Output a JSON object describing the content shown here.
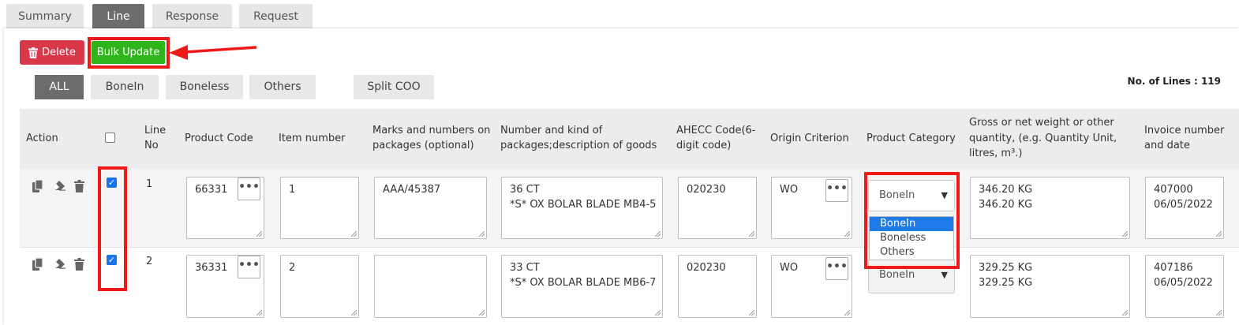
{
  "tabs": [
    "Summary",
    "Line",
    "Response",
    "Request"
  ],
  "active_tab": "Line",
  "toolbar": {
    "delete_label": "Delete",
    "bulk_update_label": "Bulk Update"
  },
  "filters": [
    "ALL",
    "BoneIn",
    "Boneless",
    "Others",
    "Split COO"
  ],
  "active_filter": "ALL",
  "lines_count_label": "No. of Lines : 119",
  "table": {
    "headers": {
      "action": "Action",
      "line_no_1": "Line",
      "line_no_2": "No",
      "product_code": "Product Code",
      "item_number": "Item number",
      "marks_1": "Marks and numbers on",
      "marks_2": "packages (optional)",
      "number_kind_1": "Number and kind of",
      "number_kind_2": "packages;description of goods",
      "ahecc_1": "AHECC Code(6-",
      "ahecc_2": "digit code)",
      "origin": "Origin Criterion",
      "category": "Product Category",
      "weight_1": "Gross or net weight or other",
      "weight_2": "quantity, (e.g. Quantity Unit,",
      "weight_3": "litres, m³.)",
      "invoice_1": "Invoice number",
      "invoice_2": "and date"
    },
    "rows": [
      {
        "checked": true,
        "line_no": "1",
        "product_code": "66331",
        "item_number": "1",
        "marks": "AAA/45387",
        "description": "36 CT\n*S* OX BOLAR BLADE MB4-5",
        "ahecc": "020230",
        "origin": "WO",
        "category": "BoneIn",
        "weight": "346.20 KG\n346.20 KG",
        "invoice": "407000\n06/05/2022"
      },
      {
        "checked": true,
        "line_no": "2",
        "product_code": "36331",
        "item_number": "2",
        "marks": "",
        "description": "33 CT\n*S* OX BOLAR BLADE MB6-7",
        "ahecc": "020230",
        "origin": "WO",
        "category": "BoneIn",
        "weight": "329.25 KG\n329.25 KG",
        "invoice": "407186\n06/05/2022"
      }
    ]
  },
  "category_dropdown": {
    "options": [
      "BoneIn",
      "Boneless",
      "Others"
    ],
    "selected": "BoneIn"
  },
  "colors": {
    "delete": "#d9384b",
    "bulk_update": "#2fb51c",
    "highlight": "#f01919",
    "active_tab": "#6c6c6c"
  },
  "icons": [
    "trash-icon",
    "copy-icon",
    "eraser-icon",
    "ellipsis-icon",
    "chevron-down-icon",
    "arrow-annotation"
  ]
}
